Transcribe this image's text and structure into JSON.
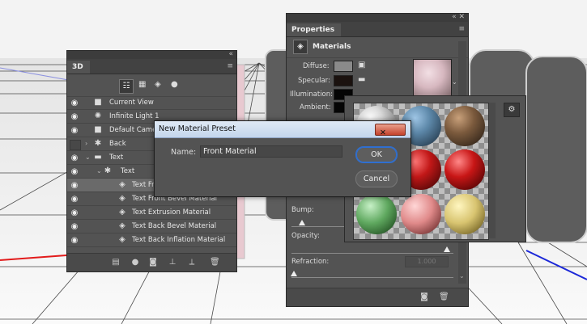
{
  "panel3d": {
    "tab": "3D",
    "layers": [
      {
        "label": "Current View"
      },
      {
        "label": "Infinite Light 1"
      },
      {
        "label": "Default Camera"
      },
      {
        "label": "Back"
      },
      {
        "label": "Text"
      },
      {
        "label": "Text"
      },
      {
        "label": "Text Front Inflation Material"
      },
      {
        "label": "Text Front Bevel Material"
      },
      {
        "label": "Text Extrusion Material"
      },
      {
        "label": "Text Back Bevel Material"
      },
      {
        "label": "Text Back Inflation Material"
      }
    ]
  },
  "properties": {
    "tab": "Properties",
    "section": "Materials",
    "diffuse": "Diffuse:",
    "specular": "Specular:",
    "illumination": "Illumination:",
    "ambient": "Ambient:",
    "bump": "Bump:",
    "opacity": "Opacity:",
    "refraction": "Refraction:",
    "refraction_value": "1.000"
  },
  "dialog": {
    "title": "New Material Preset",
    "name_label": "Name:",
    "name_value": "Front Material",
    "ok": "OK",
    "cancel": "Cancel"
  },
  "colors": {
    "panel": "#535353",
    "accent_blue": "#2f6fd1",
    "close_red": "#c4412b"
  }
}
